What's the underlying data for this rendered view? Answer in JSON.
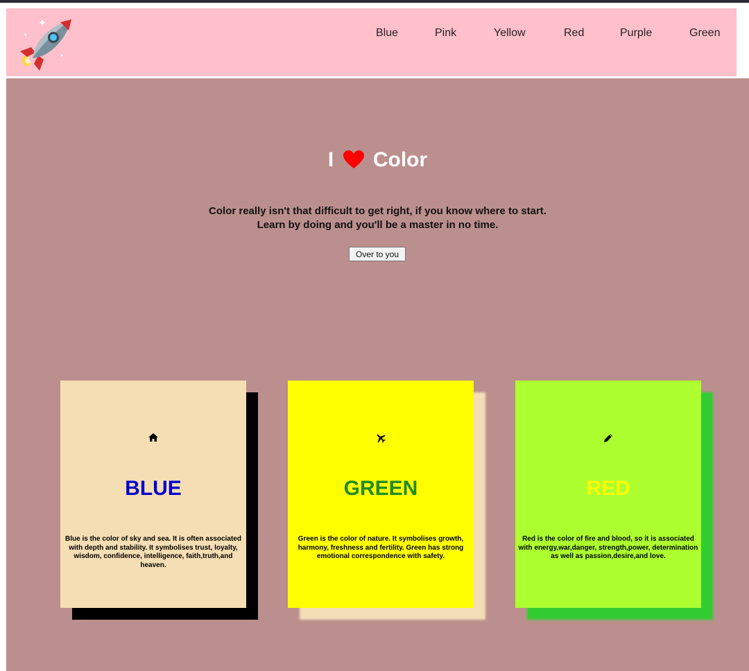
{
  "nav": {
    "links": [
      "Blue",
      "Pink",
      "Yellow",
      "Red",
      "Purple",
      "Green"
    ]
  },
  "hero": {
    "title_before": "I",
    "title_after": "Color",
    "heart_icon": "heart-icon",
    "line1": "Color really isn't that difficult to get right, if you know where to start.",
    "line2": "Learn by doing and you'll be a master in no time.",
    "button_label": "Over to you"
  },
  "cards": [
    {
      "icon": "home-icon",
      "title": "BLUE",
      "text": "Blue is the color of sky and sea. It is often associated with depth and stability. It symbolises trust, loyalty, wisdom, confidence, intelligence, faith,truth,and heaven.",
      "background": "#f5deb3",
      "title_color": "#0000cd",
      "shadow_color": "#000000"
    },
    {
      "icon": "airplane-icon",
      "title": "GREEN",
      "text": "Green is the color of nature. It symbolises growth, harmony, freshness and fertility. Green has strong emotional correspondence with safety.",
      "background": "#ffff00",
      "title_color": "#228b22",
      "shadow_color": "#f3deb8"
    },
    {
      "icon": "pencil-icon",
      "title": "RED",
      "text": "Red is the color of fire and blood, so it is associated with energy,war,danger, strength,power, determination as well as passion,desire,and love.",
      "background": "#adff2f",
      "title_color": "#ffff00",
      "shadow_color": "#32cd32"
    }
  ],
  "colors": {
    "navbar": "#ffc0cb",
    "main_background": "#bb8f8d",
    "heart": "#ff0000"
  }
}
